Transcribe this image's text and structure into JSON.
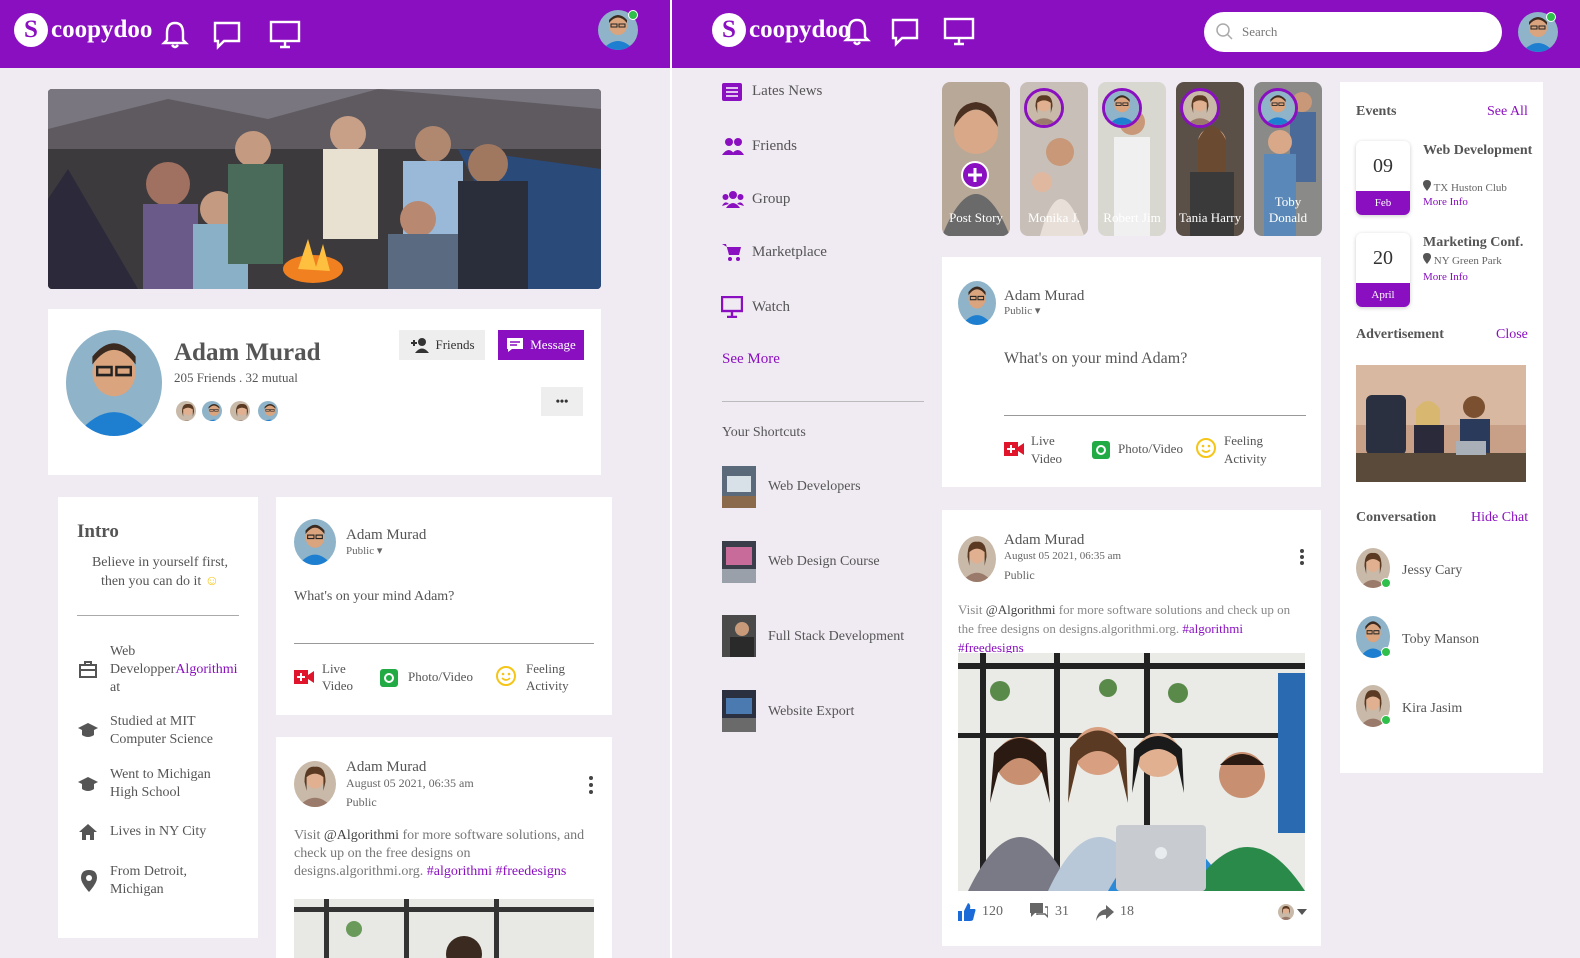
{
  "brand": {
    "initial": "S",
    "name": "coopydoo",
    "accent": "#8a0fc0"
  },
  "left": {
    "cover_alt_icon": "cover-photo",
    "profile": {
      "name": "Adam Murad",
      "stats": "205 Friends . 32 mutual",
      "friends_label": "Friends",
      "message_label": "Message",
      "more_label": "•••"
    },
    "intro": {
      "title": "Intro",
      "bio": "Believe in yourself first, then you can do it",
      "items": [
        {
          "icon": "briefcase-icon",
          "text_a": "Web Developper",
          "text_b": "at",
          "link": "Algorithmi"
        },
        {
          "icon": "graduation-cap-icon",
          "text": "Studied at MIT Computer Science"
        },
        {
          "icon": "graduation-cap-icon",
          "text": "Went to Michigan High School"
        },
        {
          "icon": "home-icon",
          "text": "Lives in NY City"
        },
        {
          "icon": "map-pin-icon",
          "text": "From Detroit, Michigan"
        }
      ]
    },
    "composer": {
      "name": "Adam Murad",
      "privacy": "Public ▾",
      "placeholder": "What's on your mind Adam?",
      "live": "Live Video",
      "photo": "Photo/Video",
      "feeling": "Feeling Activity"
    },
    "post": {
      "name": "Adam Murad",
      "date": "August 05 2021, 06:35 am",
      "privacy": "Public",
      "text_a": "Visit ",
      "mention": "@Algorithmi",
      "text_b": " for more software solutions, and check up on the free designs on designs.algorithmi.org. ",
      "tags": "#algorithmi #freedesigns"
    }
  },
  "right": {
    "search_placeholder": "Search",
    "nav": [
      {
        "icon": "news-icon",
        "label": "Lates News"
      },
      {
        "icon": "friends-icon",
        "label": "Friends"
      },
      {
        "icon": "group-icon",
        "label": "Group"
      },
      {
        "icon": "cart-icon",
        "label": "Marketplace"
      },
      {
        "icon": "monitor-icon",
        "label": "Watch"
      }
    ],
    "see_more": "See More",
    "shortcuts_title": "Your Shortcuts",
    "shortcuts": [
      "Web Developers",
      "Web Design Course",
      "Full Stack Development",
      "Website Export"
    ],
    "stories": [
      "Post Story",
      "Monika J.",
      "Robert Jim",
      "Tania Harry",
      "Toby Donald"
    ],
    "composer": {
      "name": "Adam Murad",
      "privacy": "Public ▾",
      "placeholder": "What's on your mind Adam?",
      "live": "Live Video",
      "photo": "Photo/Video",
      "feeling": "Feeling Activity"
    },
    "post": {
      "name": "Adam Murad",
      "date": "August 05 2021, 06:35 am",
      "privacy": "Public",
      "text_a": "Visit ",
      "mention": "@Algorithmi",
      "text_b": " for more software solutions and check up on the free designs on designs.algorithmi.org. ",
      "tags": "#algorithmi #freedesigns",
      "likes": "120",
      "comments": "31",
      "shares": "18"
    },
    "events": {
      "title": "Events",
      "see_all": "See All",
      "items": [
        {
          "day": "09",
          "month": "Feb",
          "title": "Web Development",
          "place": "TX Huston Club",
          "more": "More Info"
        },
        {
          "day": "20",
          "month": "April",
          "title": "Marketing Conf.",
          "place": "NY Green Park",
          "more": "More Info"
        }
      ]
    },
    "ad": {
      "title": "Advertisement",
      "close": "Close"
    },
    "conversation": {
      "title": "Conversation",
      "hide": "Hide Chat",
      "people": [
        "Jessy Cary",
        "Toby Manson",
        "Kira Jasim"
      ]
    }
  }
}
